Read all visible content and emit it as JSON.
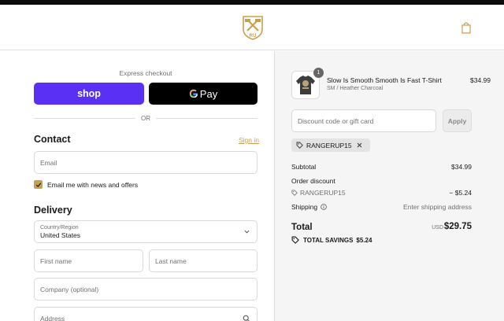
{
  "header": {
    "logo_icon": "store-crest-logo",
    "cart_icon": "shopping-bag-icon",
    "accent_color": "#c9a04d"
  },
  "express": {
    "label": "Express checkout",
    "shop_label": "shop",
    "gpay_label": "Pay",
    "or_label": "OR"
  },
  "contact": {
    "title": "Contact",
    "signin_label": "Sign in",
    "email_placeholder": "Email",
    "newsletter_label": "Email me with news and offers",
    "newsletter_checked": true
  },
  "delivery": {
    "title": "Delivery",
    "country_label": "Country/Region",
    "country_value": "United States",
    "first_name_placeholder": "First name",
    "last_name_placeholder": "Last name",
    "company_placeholder": "Company (optional)",
    "address_placeholder": "Address"
  },
  "summary": {
    "product": {
      "name": "Slow Is Smooth Smooth Is Fast T-Shirt",
      "variant": "SM / Heather Charcoal",
      "price": "$34.99",
      "quantity": "1"
    },
    "discount_placeholder": "Discount code or gift card",
    "apply_label": "Apply",
    "applied_code": "RANGERUP15",
    "subtotal_label": "Subtotal",
    "subtotal_value": "$34.99",
    "order_discount_label": "Order discount",
    "discount_code": "RANGERUP15",
    "discount_value": "− $5.24",
    "shipping_label": "Shipping",
    "shipping_value": "Enter shipping address",
    "total_label": "Total",
    "total_currency": "USD",
    "total_value": "$29.75",
    "savings_label": "TOTAL SAVINGS",
    "savings_value": "$5.24"
  }
}
